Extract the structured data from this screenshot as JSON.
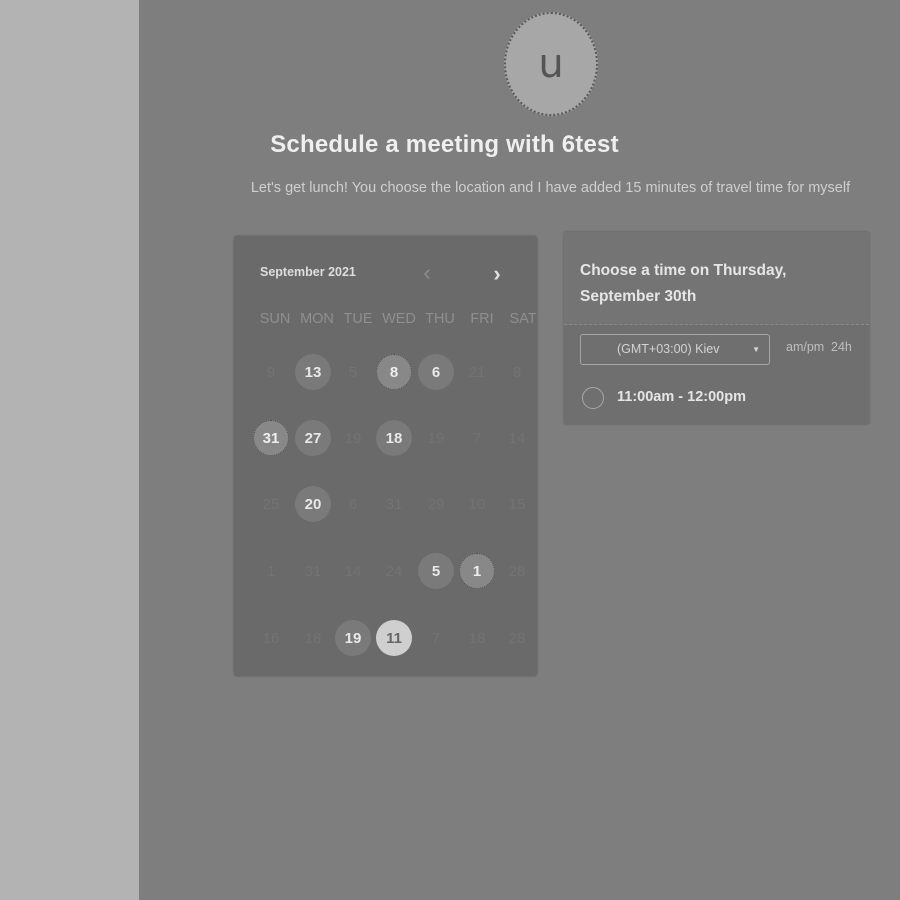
{
  "header": {
    "avatar_letter": "u",
    "title": "Schedule a meeting with 6test",
    "subtitle": "Let's get lunch! You choose the location and I have added 15 minutes of travel time for myself"
  },
  "calendar": {
    "month_label": "September 2021",
    "prev_icon": "‹",
    "next_icon": "›",
    "weekdays": [
      "SUN",
      "MON",
      "TUE",
      "WED",
      "THU",
      "FRI",
      "SAT"
    ],
    "rows": [
      [
        {
          "label": "9",
          "state": "disabled"
        },
        {
          "label": "13",
          "state": "available"
        },
        {
          "label": "5",
          "state": "disabled"
        },
        {
          "label": "8",
          "state": "busy"
        },
        {
          "label": "6",
          "state": "available"
        },
        {
          "label": "21",
          "state": "disabled"
        },
        {
          "label": "8",
          "state": "disabled"
        }
      ],
      [
        {
          "label": "31",
          "state": "busy"
        },
        {
          "label": "27",
          "state": "available"
        },
        {
          "label": "19",
          "state": "disabled"
        },
        {
          "label": "18",
          "state": "available"
        },
        {
          "label": "19",
          "state": "disabled"
        },
        {
          "label": "7",
          "state": "disabled"
        },
        {
          "label": "14",
          "state": "disabled"
        }
      ],
      [
        {
          "label": "25",
          "state": "disabled"
        },
        {
          "label": "20",
          "state": "available"
        },
        {
          "label": "6",
          "state": "disabled"
        },
        {
          "label": "31",
          "state": "disabled"
        },
        {
          "label": "29",
          "state": "disabled"
        },
        {
          "label": "10",
          "state": "disabled"
        },
        {
          "label": "15",
          "state": "disabled"
        }
      ],
      [
        {
          "label": "1",
          "state": "disabled"
        },
        {
          "label": "31",
          "state": "disabled"
        },
        {
          "label": "14",
          "state": "disabled"
        },
        {
          "label": "24",
          "state": "disabled"
        },
        {
          "label": "5",
          "state": "available"
        },
        {
          "label": "1",
          "state": "busy"
        },
        {
          "label": "28",
          "state": "disabled"
        }
      ],
      [
        {
          "label": "16",
          "state": "disabled"
        },
        {
          "label": "18",
          "state": "disabled"
        },
        {
          "label": "19",
          "state": "available"
        },
        {
          "label": "11",
          "state": "selected"
        },
        {
          "label": "7",
          "state": "disabled"
        },
        {
          "label": "18",
          "state": "disabled"
        },
        {
          "label": "28",
          "state": "disabled"
        }
      ]
    ]
  },
  "times_panel": {
    "title": "Choose a time on Thursday, September 30th",
    "timezone": "(GMT+03:00) Kiev",
    "format_ampm": "am/pm",
    "format_24h": "24h",
    "slots": [
      "11:00am - 12:00pm"
    ]
  },
  "icons": {
    "dropdown": "▼"
  }
}
